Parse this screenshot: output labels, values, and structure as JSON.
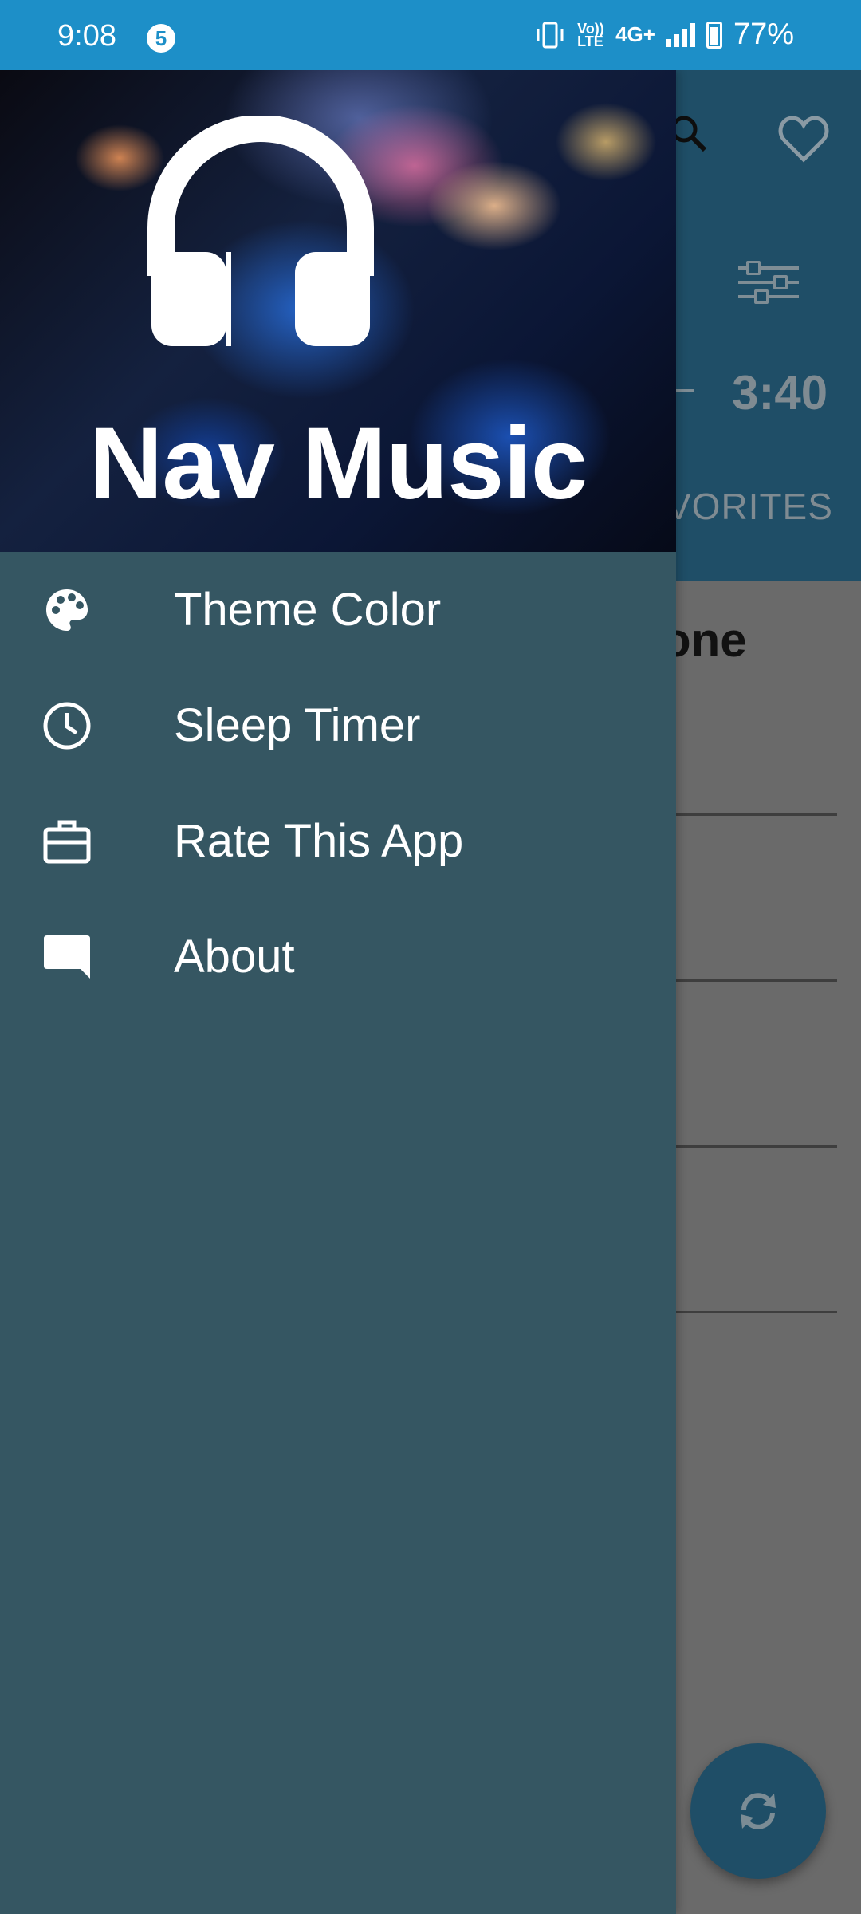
{
  "status_bar": {
    "time": "9:08",
    "notification_count": "5",
    "network_small": "Vo)) LTE",
    "network": "4G+",
    "battery": "77%"
  },
  "background_app": {
    "track_time": "3:40",
    "tab_partial": "VORITES",
    "row_title_partial": "one",
    "toolbar_color": "#1f4e67"
  },
  "drawer": {
    "title": "Nav Music",
    "header_icon": "headphones-icon",
    "background_color": "#355662",
    "items": [
      {
        "label": "Theme Color",
        "icon": "palette-icon"
      },
      {
        "label": "Sleep Timer",
        "icon": "clock-icon"
      },
      {
        "label": "Rate This App",
        "icon": "briefcase-icon"
      },
      {
        "label": "About",
        "icon": "chat-bubble-icon"
      }
    ]
  }
}
